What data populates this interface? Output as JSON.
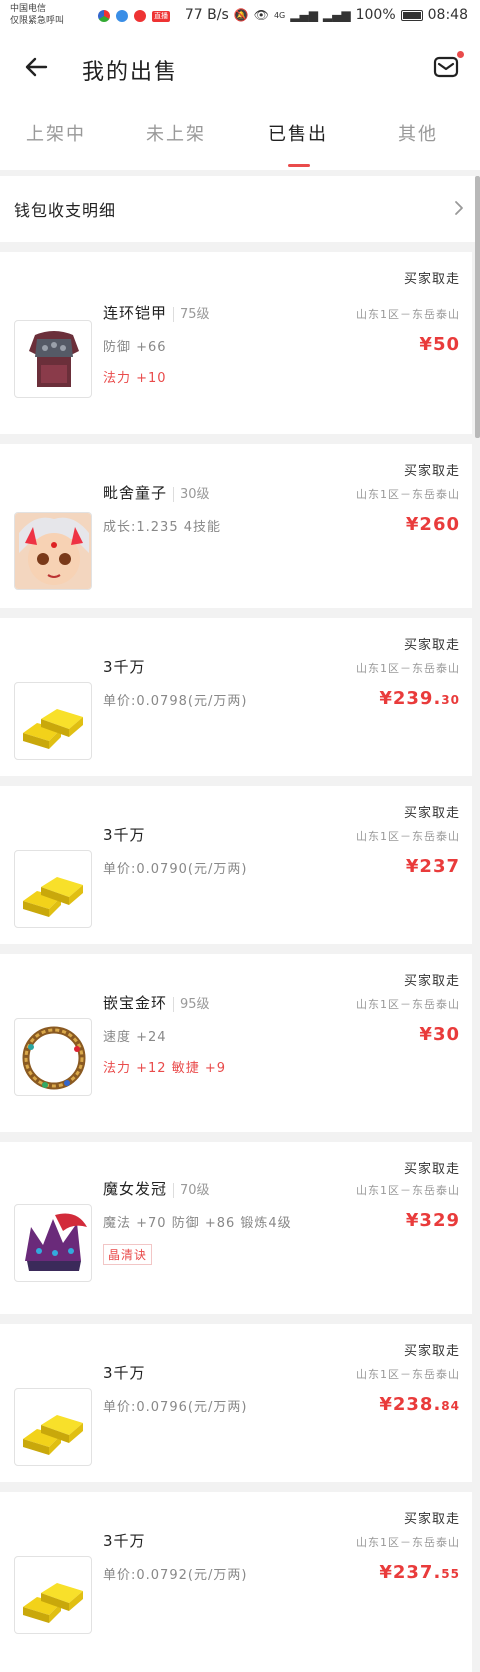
{
  "status_bar": {
    "carrier_line1": "中国电信",
    "carrier_line2": "仅限紧急呼叫",
    "app_badge": "直播",
    "net_speed": "77 B/s",
    "network": "4G",
    "battery": "100%",
    "time": "08:48"
  },
  "header": {
    "title": "我的出售"
  },
  "tabs": [
    {
      "label": "上架中"
    },
    {
      "label": "未上架"
    },
    {
      "label": "已售出"
    },
    {
      "label": "其他"
    }
  ],
  "active_tab": "已售出",
  "wallet": {
    "label": "钱包收支明细"
  },
  "items": [
    {
      "status": "买家取走",
      "name": "连环铠甲",
      "level": "75级",
      "server": "山东1区－东岳泰山",
      "attrs": [
        "防御 +66",
        "法力 +10"
      ],
      "price": "¥50",
      "price_dec": ""
    },
    {
      "status": "买家取走",
      "name": "毗舍童子",
      "level": "30级",
      "server": "山东1区－东岳泰山",
      "attrs": [
        "成长:1.235 4技能"
      ],
      "price": "¥260",
      "price_dec": ""
    },
    {
      "status": "买家取走",
      "name": "3千万",
      "level": "",
      "server": "山东1区－东岳泰山",
      "attrs": [
        "单价:0.0798(元/万两)"
      ],
      "price": "¥239.",
      "price_dec": "30"
    },
    {
      "status": "买家取走",
      "name": "3千万",
      "level": "",
      "server": "山东1区－东岳泰山",
      "attrs": [
        "单价:0.0790(元/万两)"
      ],
      "price": "¥237",
      "price_dec": ""
    },
    {
      "status": "买家取走",
      "name": "嵌宝金环",
      "level": "95级",
      "server": "山东1区－东岳泰山",
      "attrs": [
        "速度 +24",
        "法力 +12 敏捷 +9"
      ],
      "price": "¥30",
      "price_dec": ""
    },
    {
      "status": "买家取走",
      "name": "魔女发冠",
      "level": "70级",
      "server": "山东1区－东岳泰山",
      "attrs": [
        "魔法 +70 防御 +86 锻炼4级"
      ],
      "tag": "晶清诀",
      "price": "¥329",
      "price_dec": ""
    },
    {
      "status": "买家取走",
      "name": "3千万",
      "level": "",
      "server": "山东1区－东岳泰山",
      "attrs": [
        "单价:0.0796(元/万两)"
      ],
      "price": "¥238.",
      "price_dec": "84"
    },
    {
      "status": "买家取走",
      "name": "3千万",
      "level": "",
      "server": "山东1区－东岳泰山",
      "attrs": [
        "单价:0.0792(元/万两)"
      ],
      "price": "¥237.",
      "price_dec": "55"
    }
  ],
  "colors": {
    "accent": "#e94b4b",
    "background": "#f2f2f2"
  }
}
